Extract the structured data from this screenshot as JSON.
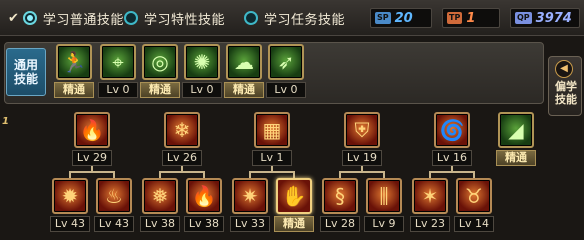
{
  "tabs": [
    {
      "label": "学习普通技能",
      "checked": true
    },
    {
      "label": "学习特性技能",
      "checked": false
    },
    {
      "label": "学习任务技能",
      "checked": false
    }
  ],
  "counters": [
    {
      "icon": "SP",
      "value": "20",
      "color": "#5fb7ff",
      "icon_bg": "#4a8ac8"
    },
    {
      "icon": "TP",
      "value": "1",
      "color": "#ff8a4a",
      "icon_bg": "#d06a3a"
    },
    {
      "icon": "QP",
      "value": "3974",
      "color": "#9ab0ff",
      "icon_bg": "#7a90e0"
    }
  ],
  "general": {
    "label_line1": "通用",
    "label_line2": "技能",
    "skills": [
      {
        "icon": "running-figure-icon",
        "glyph": "🏃",
        "level": "精通",
        "mastered": true
      },
      {
        "icon": "crosshair-icon",
        "glyph": "⌖",
        "level": "Lv 0",
        "mastered": false
      },
      {
        "icon": "target-icon",
        "glyph": "◎",
        "level": "精通",
        "mastered": true
      },
      {
        "icon": "swirl-icon",
        "glyph": "✺",
        "level": "Lv 0",
        "mastered": false
      },
      {
        "icon": "mushroom-icon",
        "glyph": "☁",
        "level": "精通",
        "mastered": true
      },
      {
        "icon": "leap-icon",
        "glyph": "➶",
        "level": "Lv 0",
        "mastered": false
      }
    ]
  },
  "side_tab": {
    "arrow": "◀",
    "line1": "偏学",
    "line2": "技能"
  },
  "tree_marker": "1",
  "tree_row1": [
    {
      "icon": "fire-icon",
      "glyph": "🔥",
      "level": "Lv 29",
      "mastered": false
    },
    {
      "icon": "snowflake-icon",
      "glyph": "❄",
      "level": "Lv 26",
      "mastered": false
    },
    {
      "icon": "net-icon",
      "glyph": "▦",
      "level": "Lv 1",
      "mastered": false
    },
    {
      "icon": "shield-icon",
      "glyph": "⛨",
      "level": "Lv 19",
      "mastered": false
    },
    {
      "icon": "vortex-icon",
      "glyph": "🌀",
      "level": "Lv 16",
      "mastered": false
    },
    {
      "icon": "slope-icon",
      "glyph": "◢",
      "level": "精通",
      "mastered": true
    }
  ],
  "tree_row2": [
    {
      "icon": "flame-burst-icon",
      "glyph": "✹",
      "level": "Lv 43",
      "mastered": false
    },
    {
      "icon": "flame-wave-icon",
      "glyph": "♨",
      "level": "Lv 43",
      "mastered": false
    },
    {
      "icon": "frost-icon",
      "glyph": "❅",
      "level": "Lv 38",
      "mastered": false
    },
    {
      "icon": "inferno-icon",
      "glyph": "🔥",
      "level": "Lv 38",
      "mastered": false
    },
    {
      "icon": "blaze-icon",
      "glyph": "✷",
      "level": "Lv 33",
      "mastered": false
    },
    {
      "icon": "hand-icon",
      "glyph": "✋",
      "level": "精通",
      "mastered": true,
      "selected": true
    },
    {
      "icon": "serpent-icon",
      "glyph": "§",
      "level": "Lv 28",
      "mastered": false
    },
    {
      "icon": "pillars-icon",
      "glyph": "⫼",
      "level": "Lv 9",
      "mastered": false
    },
    {
      "icon": "fire-pillars-icon",
      "glyph": "✶",
      "level": "Lv 23",
      "mastered": false
    },
    {
      "icon": "fire-horns-icon",
      "glyph": "♉",
      "level": "Lv 14",
      "mastered": false
    }
  ]
}
